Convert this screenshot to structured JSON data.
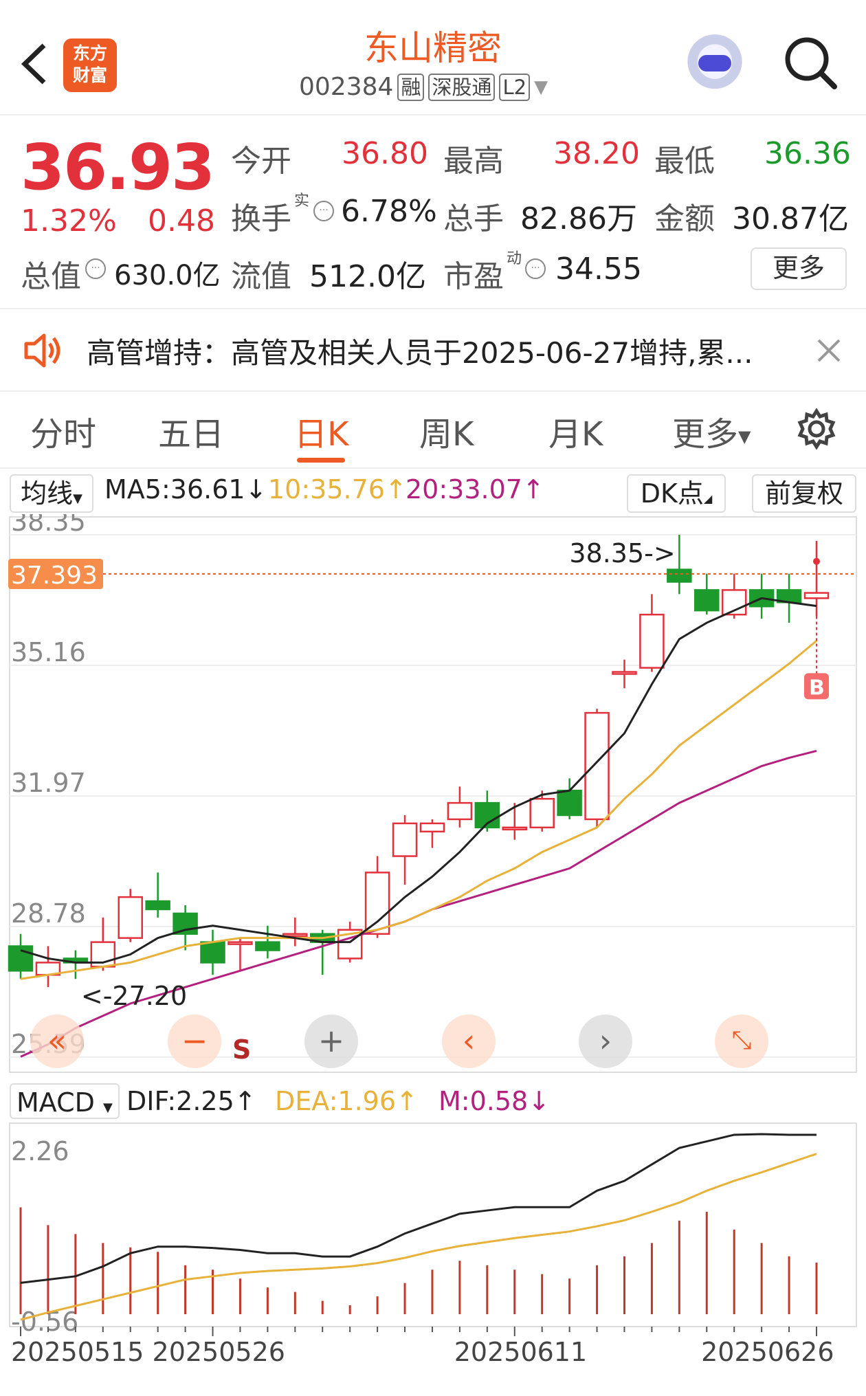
{
  "header": {
    "logo_line1": "东方",
    "logo_line2": "财富",
    "stock_name": "东山精密",
    "stock_code": "002384",
    "tags": [
      "融",
      "深股通",
      "L2"
    ]
  },
  "quote": {
    "price": "36.93",
    "change_pct": "1.32%",
    "change": "0.48",
    "open_label": "今开",
    "open": "36.80",
    "high_label": "最高",
    "high": "38.20",
    "low_label": "最低",
    "low": "36.36",
    "turnover_label": "换手",
    "turnover_sup": "实",
    "turnover": "6.78%",
    "volume_label": "总手",
    "volume": "82.86万",
    "amount_label": "金额",
    "amount": "30.87亿",
    "mktcap_label": "总值",
    "mktcap": "630.0亿",
    "float_label": "流值",
    "float_cap": "512.0亿",
    "pe_label": "市盈",
    "pe_sup": "动",
    "pe": "34.55",
    "more": "更多"
  },
  "notice": {
    "text": "高管增持：高管及相关人员于2025-06-27增持,累..."
  },
  "tabs": [
    "分时",
    "五日",
    "日K",
    "周K",
    "月K",
    "更多"
  ],
  "active_tab": "日K",
  "indicators": {
    "ma_select": "均线",
    "ma5": "MA5:36.61",
    "ma10": "10:35.76",
    "ma20": "20:33.07",
    "dk": "DK点",
    "adjust": "前复权",
    "macd_select": "MACD",
    "dif": "DIF:2.25",
    "dea": "DEA:1.96",
    "m": "M:0.58"
  },
  "colors": {
    "up": "#e2313b",
    "down": "#1d9a2c",
    "accent": "#ee5a24",
    "ma5": "#222222",
    "ma10": "#e8b23a",
    "ma20": "#b3207e"
  },
  "chart_data": {
    "type": "candlestick",
    "y_ticks": [
      "38.35",
      "35.16",
      "31.97",
      "28.78",
      "25.59"
    ],
    "ylim": [
      25.59,
      38.35
    ],
    "crosshair_price": "37.393",
    "high_annotation": "38.35->",
    "low_annotation": "<-27.20",
    "buy_marker": "B",
    "sell_marker": "S",
    "dates": [
      "20250515",
      "20250526",
      "20250611",
      "20250626"
    ],
    "candles": [
      {
        "o": 28.3,
        "h": 28.6,
        "c": 27.7,
        "l": 27.5
      },
      {
        "o": 27.6,
        "h": 28.3,
        "c": 27.9,
        "l": 27.3
      },
      {
        "o": 28.0,
        "h": 28.2,
        "c": 27.9,
        "l": 27.5
      },
      {
        "o": 27.8,
        "h": 29.0,
        "c": 28.4,
        "l": 27.7
      },
      {
        "o": 28.5,
        "h": 29.7,
        "c": 29.5,
        "l": 28.4
      },
      {
        "o": 29.4,
        "h": 30.1,
        "c": 29.2,
        "l": 29.0
      },
      {
        "o": 29.1,
        "h": 29.3,
        "c": 28.6,
        "l": 28.2
      },
      {
        "o": 28.4,
        "h": 28.7,
        "c": 27.9,
        "l": 27.6
      },
      {
        "o": 28.4,
        "h": 28.5,
        "c": 28.4,
        "l": 27.7
      },
      {
        "o": 28.4,
        "h": 28.8,
        "c": 28.2,
        "l": 28.0
      },
      {
        "o": 28.6,
        "h": 29.0,
        "c": 28.6,
        "l": 28.3
      },
      {
        "o": 28.6,
        "h": 28.7,
        "c": 28.4,
        "l": 27.6
      },
      {
        "o": 28.0,
        "h": 28.9,
        "c": 28.7,
        "l": 27.9
      },
      {
        "o": 28.6,
        "h": 30.5,
        "c": 30.1,
        "l": 28.5
      },
      {
        "o": 30.5,
        "h": 31.5,
        "c": 31.3,
        "l": 29.8
      },
      {
        "o": 31.1,
        "h": 31.4,
        "c": 31.3,
        "l": 30.7
      },
      {
        "o": 31.4,
        "h": 32.2,
        "c": 31.8,
        "l": 31.2
      },
      {
        "o": 31.8,
        "h": 32.1,
        "c": 31.2,
        "l": 31.1
      },
      {
        "o": 31.2,
        "h": 31.8,
        "c": 31.2,
        "l": 30.9
      },
      {
        "o": 31.2,
        "h": 32.1,
        "c": 31.9,
        "l": 31.1
      },
      {
        "o": 32.1,
        "h": 32.4,
        "c": 31.5,
        "l": 31.4
      },
      {
        "o": 31.4,
        "h": 34.1,
        "c": 34.0,
        "l": 31.2
      },
      {
        "o": 35.0,
        "h": 35.3,
        "c": 35.0,
        "l": 34.6
      },
      {
        "o": 35.1,
        "h": 36.9,
        "c": 36.4,
        "l": 35.0
      },
      {
        "o": 37.5,
        "h": 38.35,
        "c": 37.2,
        "l": 36.9
      },
      {
        "o": 37.0,
        "h": 37.4,
        "c": 36.5,
        "l": 36.4
      },
      {
        "o": 36.4,
        "h": 37.4,
        "c": 37.0,
        "l": 36.3
      },
      {
        "o": 37.0,
        "h": 37.4,
        "c": 36.6,
        "l": 36.3
      },
      {
        "o": 37.0,
        "h": 37.4,
        "c": 36.7,
        "l": 36.2
      },
      {
        "o": 36.8,
        "h": 38.2,
        "c": 36.93,
        "l": 36.36
      }
    ],
    "ma5": [
      28.2,
      28.0,
      27.9,
      27.9,
      28.1,
      28.5,
      28.7,
      28.8,
      28.7,
      28.6,
      28.5,
      28.4,
      28.4,
      28.9,
      29.5,
      30.0,
      30.6,
      31.3,
      31.7,
      32.0,
      32.1,
      32.8,
      33.5,
      34.7,
      35.8,
      36.2,
      36.5,
      36.8,
      36.7,
      36.61
    ],
    "ma10": [
      27.5,
      27.6,
      27.7,
      27.8,
      27.9,
      28.1,
      28.3,
      28.4,
      28.5,
      28.5,
      28.5,
      28.5,
      28.6,
      28.7,
      28.9,
      29.2,
      29.5,
      29.9,
      30.2,
      30.6,
      30.9,
      31.2,
      31.9,
      32.5,
      33.2,
      33.7,
      34.2,
      34.7,
      35.2,
      35.76
    ],
    "ma20": [
      25.6,
      25.9,
      26.3,
      26.6,
      26.9,
      27.1,
      27.3,
      27.5,
      27.7,
      27.9,
      28.1,
      28.3,
      28.5,
      28.7,
      28.9,
      29.2,
      29.4,
      29.6,
      29.8,
      30.0,
      30.2,
      30.6,
      31.0,
      31.4,
      31.8,
      32.1,
      32.4,
      32.7,
      32.9,
      33.07
    ],
    "macd_ticks": [
      "2.26",
      "-0.56"
    ],
    "macd_ylim": [
      -0.56,
      2.26
    ],
    "dif_series": [
      0.0,
      0.05,
      0.1,
      0.25,
      0.45,
      0.55,
      0.55,
      0.53,
      0.5,
      0.45,
      0.45,
      0.4,
      0.4,
      0.55,
      0.75,
      0.9,
      1.05,
      1.1,
      1.15,
      1.15,
      1.15,
      1.4,
      1.55,
      1.8,
      2.05,
      2.15,
      2.25,
      2.26,
      2.25,
      2.25
    ],
    "dea_series": [
      -0.56,
      -0.45,
      -0.35,
      -0.25,
      -0.15,
      -0.05,
      0.05,
      0.1,
      0.15,
      0.18,
      0.2,
      0.22,
      0.25,
      0.3,
      0.38,
      0.48,
      0.56,
      0.62,
      0.68,
      0.73,
      0.78,
      0.86,
      0.95,
      1.08,
      1.22,
      1.4,
      1.55,
      1.68,
      1.82,
      1.96
    ],
    "macd_bars": [
      1.2,
      1.0,
      0.9,
      0.8,
      0.75,
      0.7,
      0.55,
      0.5,
      0.4,
      0.3,
      0.25,
      0.15,
      0.1,
      0.2,
      0.35,
      0.5,
      0.6,
      0.55,
      0.5,
      0.45,
      0.4,
      0.55,
      0.65,
      0.8,
      1.05,
      1.15,
      0.95,
      0.8,
      0.65,
      0.58
    ]
  }
}
